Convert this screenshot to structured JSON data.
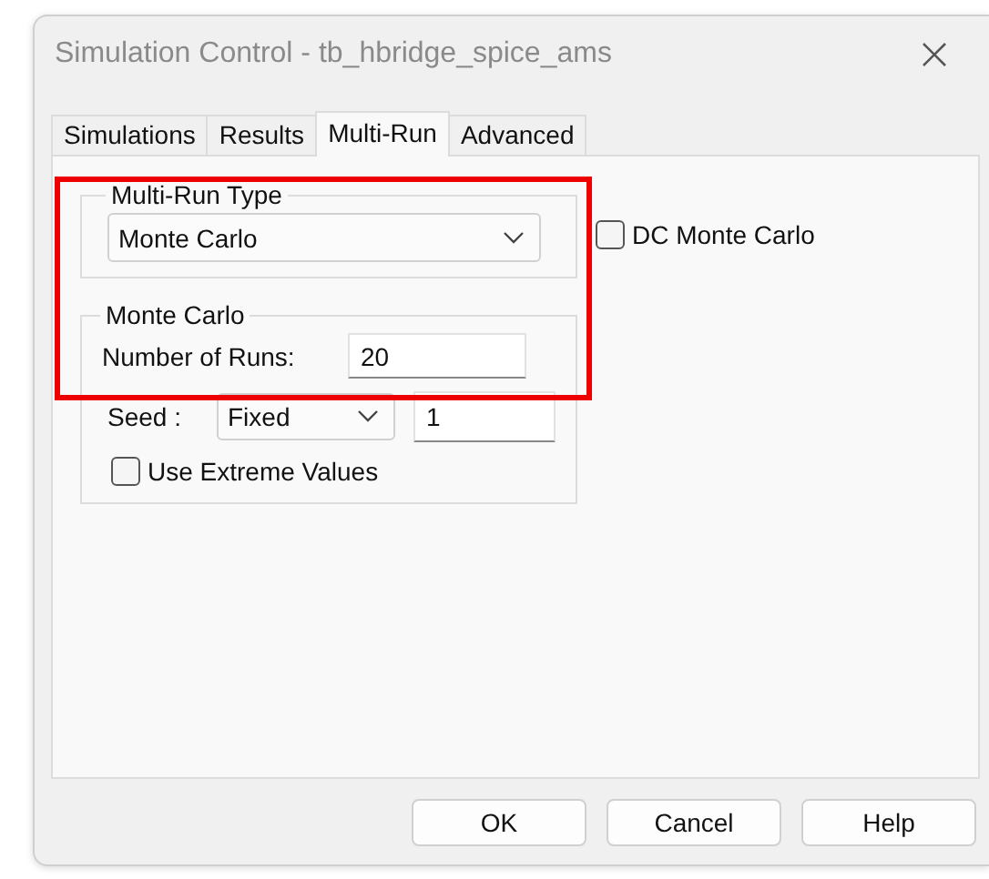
{
  "window": {
    "title": "Simulation Control - tb_hbridge_spice_ams"
  },
  "tabs": [
    {
      "label": "Simulations",
      "selected": false
    },
    {
      "label": "Results",
      "selected": false
    },
    {
      "label": "Multi-Run",
      "selected": true
    },
    {
      "label": "Advanced",
      "selected": false
    }
  ],
  "multi_run_type": {
    "label": "Multi-Run Type",
    "value": "Monte Carlo"
  },
  "dc_monte_carlo": {
    "label": "DC Monte Carlo",
    "checked": false
  },
  "monte_carlo": {
    "label": "Monte Carlo",
    "number_of_runs": {
      "label": "Number of Runs:",
      "value": "20"
    },
    "seed": {
      "label": "Seed :",
      "mode": "Fixed",
      "value": "1"
    },
    "use_extreme_values": {
      "label": "Use Extreme Values",
      "checked": false
    }
  },
  "buttons": [
    "OK",
    "Cancel",
    "Help"
  ]
}
